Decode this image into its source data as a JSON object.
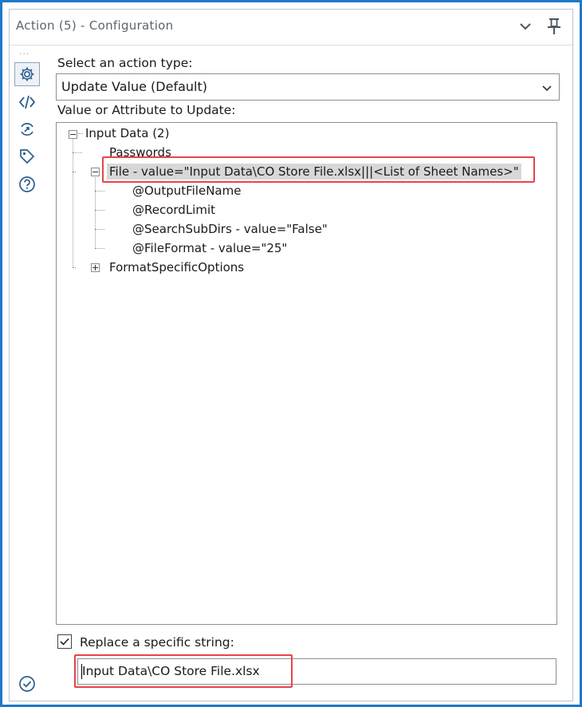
{
  "window": {
    "title": "Action (5) - Configuration"
  },
  "sidebar": {
    "items": [
      {
        "icon": "gear-icon"
      },
      {
        "icon": "code-icon"
      },
      {
        "icon": "refresh-target-icon"
      },
      {
        "icon": "tag-icon"
      },
      {
        "icon": "help-icon"
      }
    ],
    "footer_icon": "check-circle-icon"
  },
  "action_type": {
    "label": "Select an action type:",
    "value": "Update Value (Default)"
  },
  "tree": {
    "label": "Value or Attribute to Update:",
    "root": "Input Data (2)",
    "passwords": "Passwords",
    "file": "File - value=\"Input Data\\CO Store File.xlsx|||<List of Sheet Names>\"",
    "file_children": [
      "@OutputFileName",
      "@RecordLimit",
      "@SearchSubDirs - value=\"False\"",
      "@FileFormat - value=\"25\""
    ],
    "format_options": "FormatSpecificOptions"
  },
  "replace": {
    "label": "Replace a specific string:",
    "checked": true,
    "value": "Input Data\\CO Store File.xlsx"
  },
  "colors": {
    "accent_border": "#1e78c8",
    "highlight": "#e8434a",
    "selected_row": "#d7d7d7"
  }
}
